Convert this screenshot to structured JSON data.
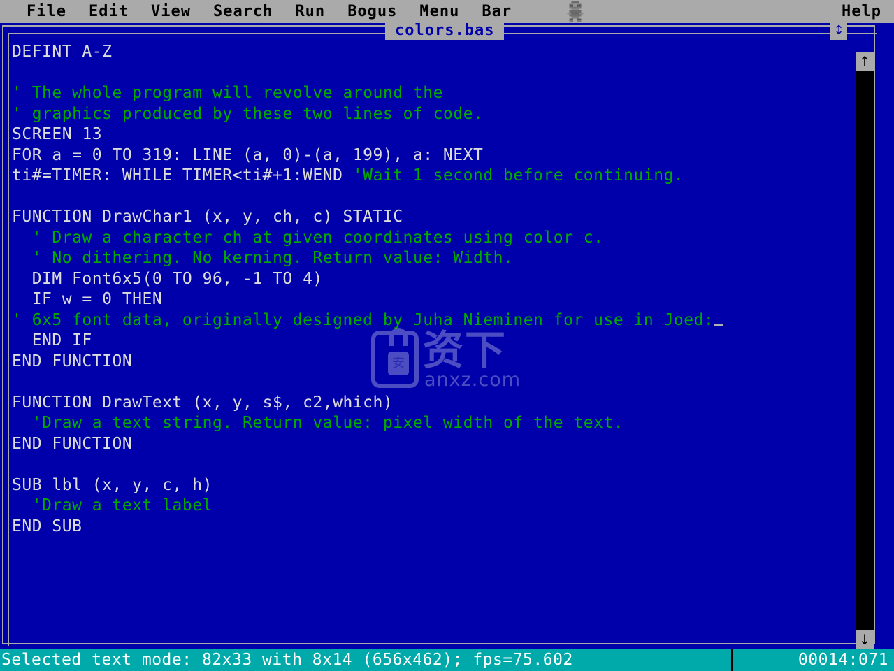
{
  "menubar": {
    "items": [
      {
        "label": "File",
        "name": "menu-file"
      },
      {
        "label": "Edit",
        "name": "menu-edit"
      },
      {
        "label": "View",
        "name": "menu-view"
      },
      {
        "label": "Search",
        "name": "menu-search"
      },
      {
        "label": "Run",
        "name": "menu-run"
      },
      {
        "label": "Bogus",
        "name": "menu-bogus"
      },
      {
        "label": "Menu",
        "name": "menu-menu"
      },
      {
        "label": "Bar",
        "name": "menu-bar"
      }
    ],
    "help_label": "Help",
    "sprite_icon": "character-sprite-icon",
    "background_color": "#aaaaaa",
    "text_color": "#000000"
  },
  "window": {
    "title": "colors.bas",
    "resize_icon": "↕",
    "background_color": "#0000aa",
    "border_color": "#aaaaaa",
    "title_color": "#0000aa"
  },
  "scrollbar": {
    "up_icon": "↑",
    "down_icon": "↓",
    "track_color": "#000000",
    "thumb_color": "#aaaaaa"
  },
  "editor": {
    "code_color": "#dcdcdc",
    "comment_color": "#00aa00",
    "cursor": "_",
    "lines": [
      [
        {
          "t": "DEFINT A-Z",
          "k": "code"
        }
      ],
      [],
      [
        {
          "t": "' The whole program will revolve around the",
          "k": "comment"
        }
      ],
      [
        {
          "t": "' graphics produced by these two lines of code.",
          "k": "comment"
        }
      ],
      [
        {
          "t": "SCREEN 13",
          "k": "code"
        }
      ],
      [
        {
          "t": "FOR a = 0 TO 319: LINE (a, 0)-(a, 199), a: NEXT",
          "k": "code"
        }
      ],
      [
        {
          "t": "ti#=TIMER: WHILE TIMER<ti#+1:WEND ",
          "k": "code"
        },
        {
          "t": "'Wait 1 second before continuing.",
          "k": "comment"
        }
      ],
      [],
      [
        {
          "t": "FUNCTION DrawChar1 (x, y, ch, c) STATIC",
          "k": "code"
        }
      ],
      [
        {
          "t": "  ' Draw a character ch at given coordinates using color c.",
          "k": "comment"
        }
      ],
      [
        {
          "t": "  ' No dithering. No kerning. Return value: Width.",
          "k": "comment"
        }
      ],
      [
        {
          "t": "  DIM Font6x5(0 TO 96, -1 TO 4)",
          "k": "code"
        }
      ],
      [
        {
          "t": "  IF w = 0 THEN",
          "k": "code"
        }
      ],
      [
        {
          "t": "' 6x5 font data, originally designed by Juha Nieminen for use in Joed:",
          "k": "comment"
        },
        {
          "t": "CURSOR",
          "k": "cursor"
        }
      ],
      [
        {
          "t": "  END IF",
          "k": "code"
        }
      ],
      [
        {
          "t": "END FUNCTION",
          "k": "code"
        }
      ],
      [],
      [
        {
          "t": "FUNCTION DrawText (x, y, s$, c2,which)",
          "k": "code"
        }
      ],
      [
        {
          "t": "  'Draw a text string. Return value: pixel width of the text.",
          "k": "comment"
        }
      ],
      [
        {
          "t": "END FUNCTION",
          "k": "code"
        }
      ],
      [],
      [
        {
          "t": "SUB lbl (x, y, c, h)",
          "k": "code"
        }
      ],
      [
        {
          "t": "  'Draw a text label",
          "k": "comment"
        }
      ],
      [
        {
          "t": "END SUB",
          "k": "code"
        }
      ]
    ]
  },
  "statusbar": {
    "message": "Selected text mode: 82x33 with 8x14 (656x462); fps=75.602",
    "position": "00014:071",
    "background_color": "#00aaaa",
    "text_color": "#ffffff"
  },
  "watermark": {
    "title": "资下",
    "subtitle": "anxz.com",
    "badge_glyph": "安"
  }
}
